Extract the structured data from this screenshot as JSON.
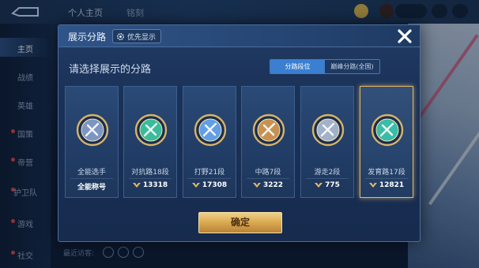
{
  "topbar": {
    "tab1": "个人主页",
    "tab2": "铭刻"
  },
  "sidenav": [
    {
      "label": "主页",
      "active": true,
      "dot": false
    },
    {
      "label": "战绩",
      "active": false,
      "dot": false
    },
    {
      "label": "英雄",
      "active": false,
      "dot": false
    },
    {
      "label": "国策",
      "active": false,
      "dot": true
    },
    {
      "label": "帝营",
      "active": false,
      "dot": true
    },
    {
      "label": "护卫队",
      "active": false,
      "dot": true
    },
    {
      "label": "游戏",
      "active": false,
      "dot": true
    },
    {
      "label": "社交",
      "active": false,
      "dot": true
    }
  ],
  "bottom_bar": {
    "text": "最近访客:"
  },
  "modal": {
    "title": "展示分路",
    "priority_button": "优先显示",
    "subtitle": "请选择展示的分路",
    "segments": [
      {
        "label": "分路段位",
        "active": true
      },
      {
        "label": "巅峰分路(全国)",
        "active": false
      }
    ],
    "cards": [
      {
        "label": "全能选手",
        "score": "全能称号",
        "emblem": "all-round-emblem",
        "color": "#8fa8d8",
        "selected": false,
        "has_rank_icon": false
      },
      {
        "label": "对抗路18段",
        "score": "13318",
        "emblem": "clash-lane-emblem",
        "color": "#3fd6a8",
        "selected": false,
        "has_rank_icon": true
      },
      {
        "label": "打野21段",
        "score": "17308",
        "emblem": "jungle-emblem",
        "color": "#6fb4ff",
        "selected": false,
        "has_rank_icon": true
      },
      {
        "label": "中路7段",
        "score": "3222",
        "emblem": "mid-lane-emblem",
        "color": "#e6a552",
        "selected": false,
        "has_rank_icon": true
      },
      {
        "label": "游走2段",
        "score": "775",
        "emblem": "roam-emblem",
        "color": "#b9c9df",
        "selected": false,
        "has_rank_icon": true
      },
      {
        "label": "发育路17段",
        "score": "12821",
        "emblem": "farm-lane-emblem",
        "color": "#3fd6b8",
        "selected": true,
        "has_rank_icon": true
      }
    ],
    "confirm_label": "确定"
  },
  "colors": {
    "accent_gold": "#e6b763",
    "segment_active": "#3a7fd0",
    "panel_bg": "#1b3258"
  }
}
